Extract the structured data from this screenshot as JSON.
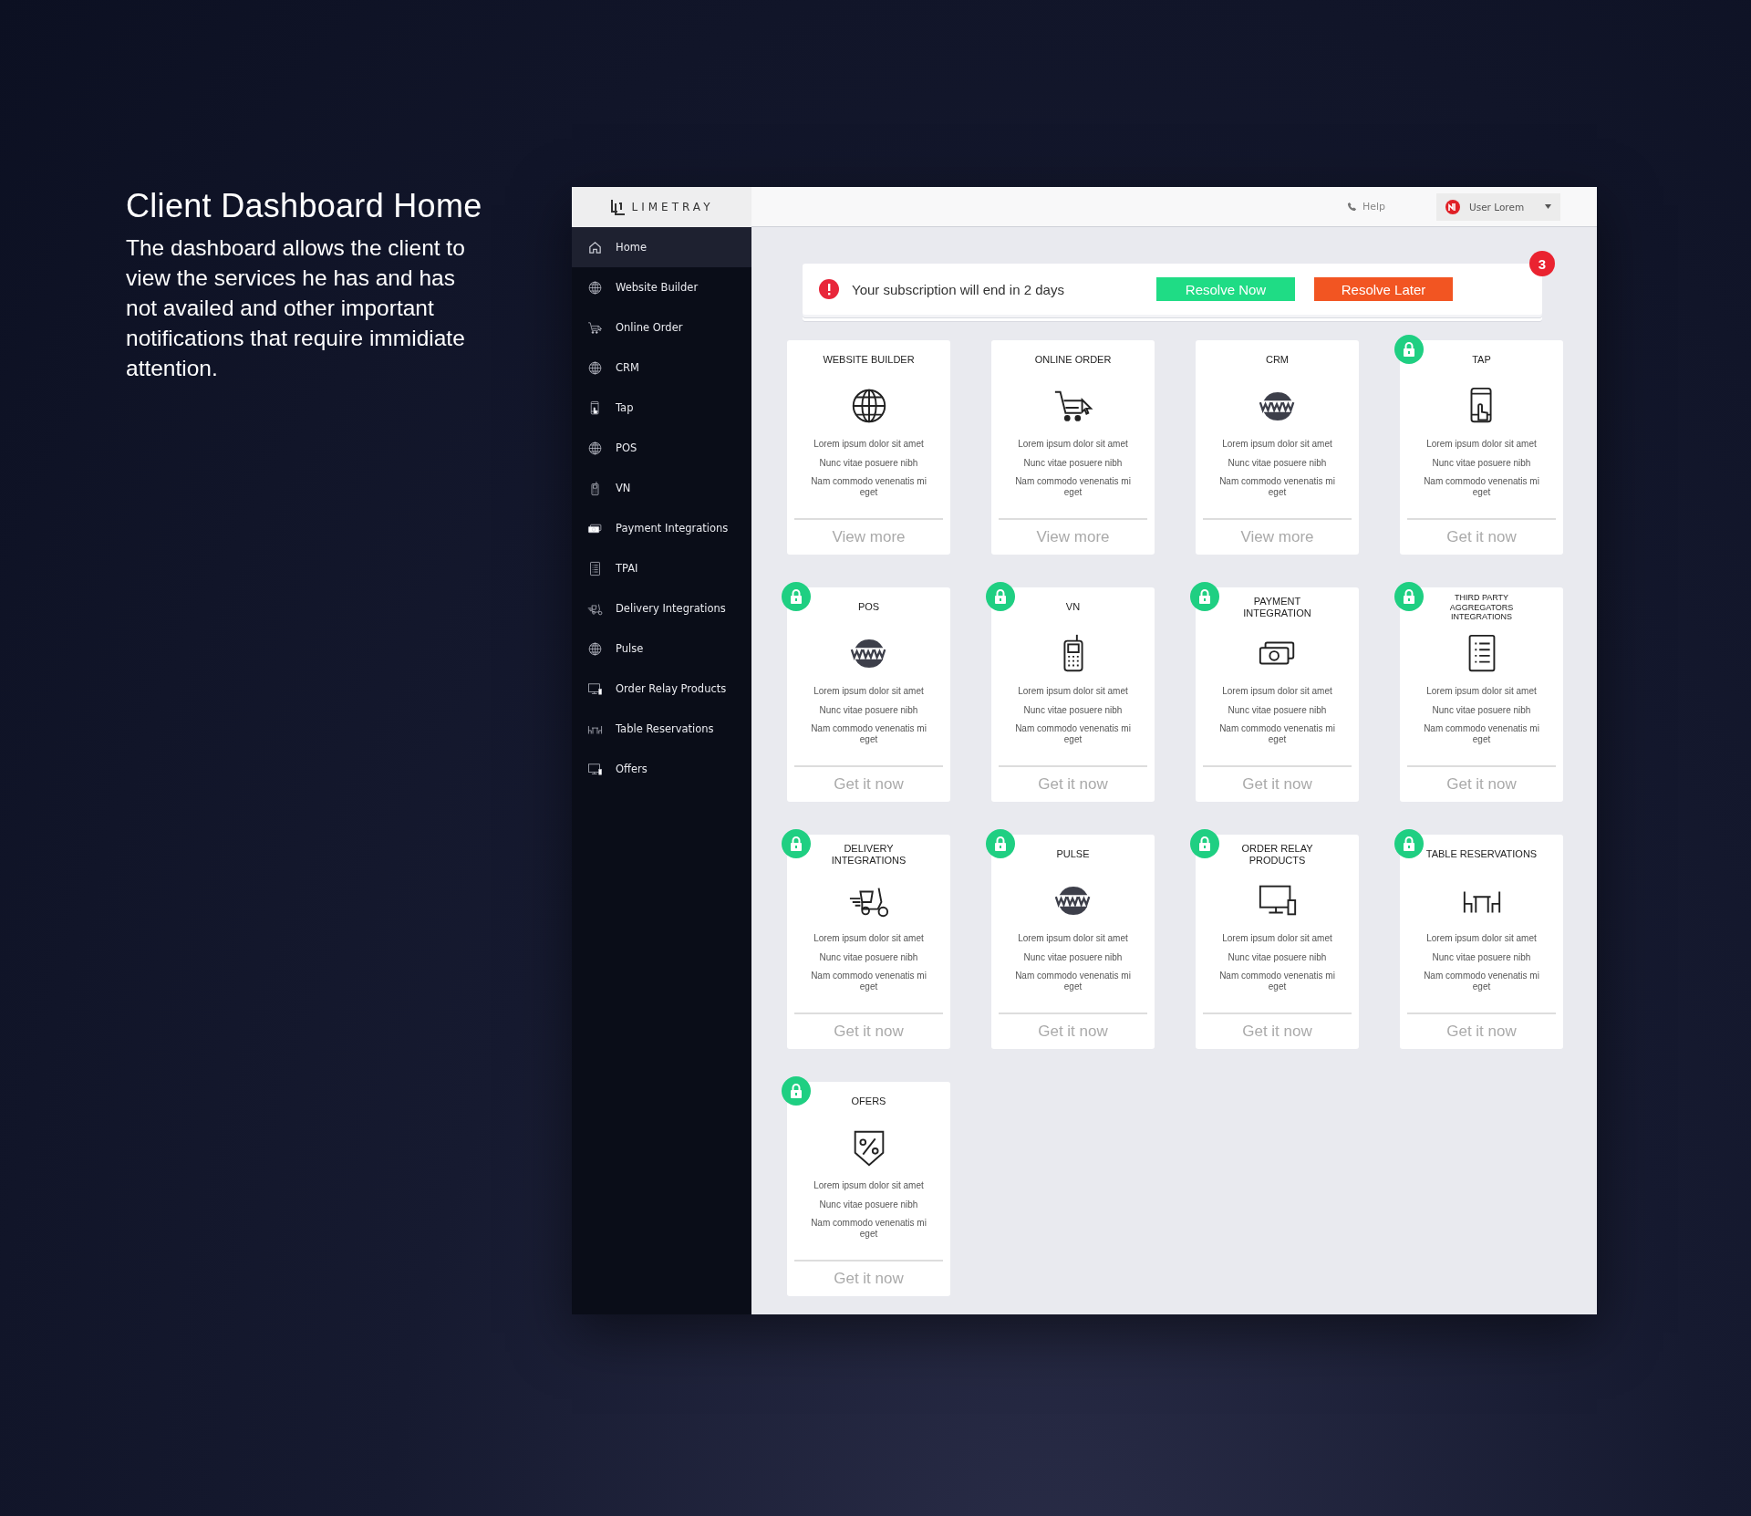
{
  "intro": {
    "title": "Client Dashboard Home",
    "text": "The dashboard allows the client to view the services he has and has not availed and other important notifications that require immidiate attention."
  },
  "logo": {
    "text": "LIMETRAY"
  },
  "header": {
    "help": "Help",
    "user": "User Lorem"
  },
  "sidebar": {
    "items": [
      {
        "label": "Home",
        "kind": "home",
        "selected": true
      },
      {
        "label": "Website Builder",
        "kind": "globe",
        "selected": false
      },
      {
        "label": "Online Order",
        "kind": "cart",
        "selected": false
      },
      {
        "label": "CRM",
        "kind": "globe",
        "selected": false
      },
      {
        "label": "Tap",
        "kind": "tap",
        "selected": false
      },
      {
        "label": "POS",
        "kind": "globe",
        "selected": false
      },
      {
        "label": "VN",
        "kind": "phone",
        "selected": false
      },
      {
        "label": "Payment Integrations",
        "kind": "money",
        "selected": false
      },
      {
        "label": "TPAI",
        "kind": "list",
        "selected": false
      },
      {
        "label": "Delivery Integrations",
        "kind": "scooter",
        "selected": false
      },
      {
        "label": "Pulse",
        "kind": "globe",
        "selected": false
      },
      {
        "label": "Order Relay Products",
        "kind": "monitor",
        "selected": false
      },
      {
        "label": "Table Reservations",
        "kind": "table",
        "selected": false
      },
      {
        "label": "Offers",
        "kind": "monitor",
        "selected": false
      }
    ]
  },
  "notification": {
    "message": "Your subscription will end in 2 days",
    "primary": "Resolve Now",
    "secondary": "Resolve Later",
    "count": "3"
  },
  "cards": [
    {
      "title": "WEBSITE BUILDER",
      "kind": "globe",
      "locked": false,
      "lines": [
        "Lorem ipsum dolor sit amet",
        "Nunc vitae posuere nibh",
        "Nam commodo venenatis mi eget"
      ],
      "action": "View more"
    },
    {
      "title": "ONLINE ORDER",
      "kind": "cart",
      "locked": false,
      "lines": [
        "Lorem ipsum dolor sit amet",
        "Nunc vitae posuere nibh",
        "Nam commodo venenatis mi eget"
      ],
      "action": "View more"
    },
    {
      "title": "CRM",
      "kind": "www",
      "locked": false,
      "lines": [
        "Lorem ipsum dolor sit amet",
        "Nunc vitae posuere nibh",
        "Nam commodo venenatis mi eget"
      ],
      "action": "View more"
    },
    {
      "title": "TAP",
      "kind": "tap",
      "locked": true,
      "lines": [
        "Lorem ipsum dolor sit amet",
        "Nunc vitae posuere nibh",
        "Nam commodo venenatis mi eget"
      ],
      "action": "Get it now"
    },
    {
      "title": "POS",
      "kind": "www",
      "locked": true,
      "lines": [
        "Lorem ipsum dolor sit amet",
        "Nunc vitae posuere nibh",
        "Nam commodo venenatis mi eget"
      ],
      "action": "Get it now"
    },
    {
      "title": "VN",
      "kind": "phone",
      "locked": true,
      "lines": [
        "Lorem ipsum dolor sit amet",
        "Nunc vitae posuere nibh",
        "Nam commodo venenatis mi eget"
      ],
      "action": "Get it now"
    },
    {
      "title": "PAYMENT INTEGRATION",
      "kind": "money",
      "locked": true,
      "lines": [
        "Lorem ipsum dolor sit amet",
        "Nunc vitae posuere nibh",
        "Nam commodo venenatis mi eget"
      ],
      "action": "Get it now"
    },
    {
      "title": "THIRD PARTY AGGREGATORS INTEGRATIONS",
      "kind": "list",
      "locked": true,
      "lines": [
        "Lorem ipsum dolor sit amet",
        "Nunc vitae posuere nibh",
        "Nam commodo venenatis mi eget"
      ],
      "action": "Get it now"
    },
    {
      "title": "DELIVERY INTEGRATIONS",
      "kind": "scooter",
      "locked": true,
      "lines": [
        "Lorem ipsum dolor sit amet",
        "Nunc vitae posuere nibh",
        "Nam commodo venenatis mi eget"
      ],
      "action": "Get it now"
    },
    {
      "title": "PULSE",
      "kind": "www",
      "locked": true,
      "lines": [
        "Lorem ipsum dolor sit amet",
        "Nunc vitae posuere nibh",
        "Nam commodo venenatis mi eget"
      ],
      "action": "Get it now"
    },
    {
      "title": "ORDER RELAY PRODUCTS",
      "kind": "monitor",
      "locked": true,
      "lines": [
        "Lorem ipsum dolor sit amet",
        "Nunc vitae posuere nibh",
        "Nam commodo venenatis mi eget"
      ],
      "action": "Get it now"
    },
    {
      "title": "TABLE RESERVATIONS",
      "kind": "table",
      "locked": true,
      "lines": [
        "Lorem ipsum dolor sit amet",
        "Nunc vitae posuere nibh",
        "Nam commodo venenatis mi eget"
      ],
      "action": "Get it now"
    },
    {
      "title": "OFERS",
      "kind": "percent",
      "locked": true,
      "lines": [
        "Lorem ipsum dolor sit amet",
        "Nunc vitae posuere nibh",
        "Nam commodo venenatis mi eget"
      ],
      "action": "Get it now"
    }
  ]
}
